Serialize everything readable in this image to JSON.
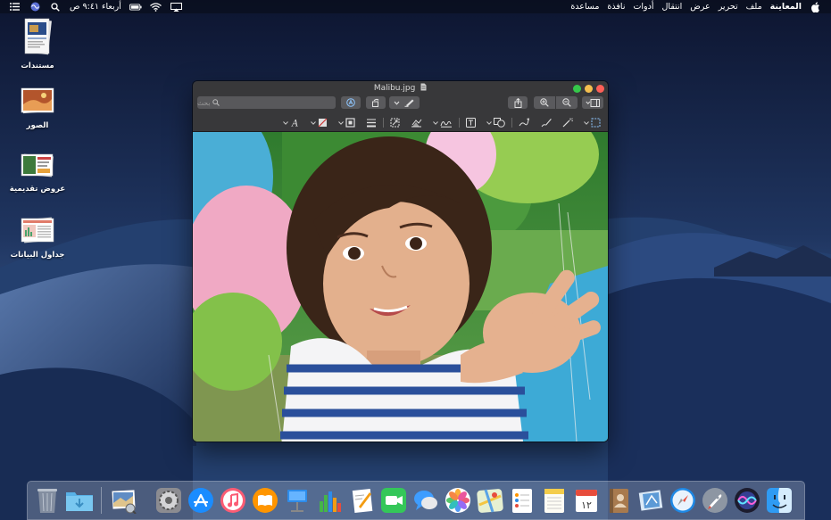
{
  "menubar": {
    "apple_icon": "apple-icon",
    "app_name": "المعاينة",
    "menus": [
      "ملف",
      "تحرير",
      "عرض",
      "انتقال",
      "أدوات",
      "نافذة",
      "مساعدة"
    ],
    "clock": "أربعاء ٩:٤١ ص",
    "status_icons": [
      "notification-center-icon",
      "siri-icon",
      "spotlight-icon",
      "battery-icon",
      "wifi-icon",
      "airplay-icon"
    ]
  },
  "desktop": {
    "icons": [
      {
        "label": "مستندات",
        "icon": "documents-stack-icon"
      },
      {
        "label": "الصور",
        "icon": "photos-stack-icon"
      },
      {
        "label": "عروض تقديمية",
        "icon": "presentations-stack-icon"
      },
      {
        "label": "جداول البيانات",
        "icon": "spreadsheets-stack-icon"
      }
    ]
  },
  "window": {
    "title": "Malibu.jpg",
    "search_placeholder": "بحث",
    "toolbar_icons": [
      "sidebar-icon",
      "zoom-out-icon",
      "zoom-in-icon",
      "share-icon",
      "rotate-icon",
      "markup-icon",
      "highlight-icon",
      "pen-icon"
    ],
    "markup_icons": [
      "rectangular-selection-icon",
      "instant-alpha-icon",
      "sketch-icon",
      "draw-icon",
      "shapes-icon",
      "text-icon",
      "sign-icon",
      "adjust-color-icon",
      "adjust-size-icon",
      "shape-style-icon",
      "border-color-icon",
      "fill-color-icon",
      "text-style-icon"
    ]
  },
  "dock": {
    "apps": [
      "Finder",
      "Siri",
      "Launchpad",
      "Safari",
      "Mail",
      "Notes",
      "Calendar",
      "Notes",
      "Reminders",
      "Maps",
      "Photos",
      "Messages",
      "FaceTime",
      "Pages",
      "Numbers",
      "Keynote",
      "Books",
      "iTunes",
      "App Store",
      "System Preferences",
      "Preview",
      "Downloads",
      "Trash"
    ],
    "colors": {
      "safari": "#1e88e5",
      "facetime": "#34c759",
      "itunes": "#fb5c74",
      "books": "#ff9500",
      "appstore": "#1a8cff"
    }
  }
}
